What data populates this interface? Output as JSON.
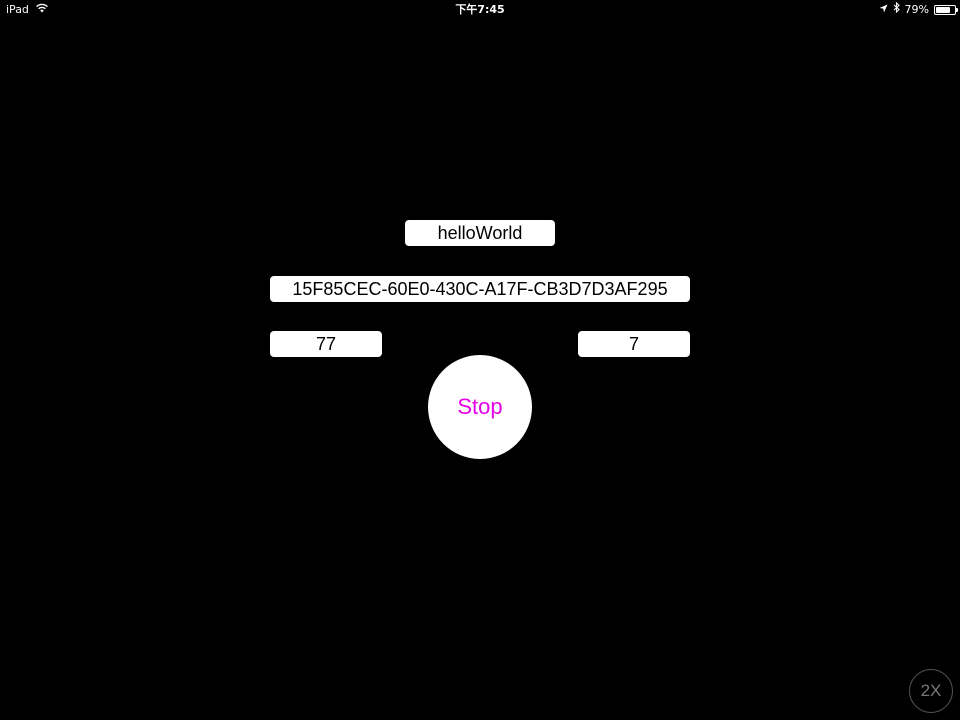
{
  "status_bar": {
    "device": "iPad",
    "time": "下午7:45",
    "battery_percent": "79%",
    "battery_level": 0.79,
    "icons": [
      "wifi-icon",
      "location-arrow-icon",
      "bluetooth-icon",
      "battery-icon"
    ]
  },
  "main": {
    "title_field": "helloWorld",
    "uuid_field": "15F85CEC-60E0-430C-A17F-CB3D7D3AF295",
    "left_value": "77",
    "right_value": "7",
    "stop_button_label": "Stop"
  },
  "zoom_button": {
    "label": "2X"
  },
  "colors": {
    "background": "#000000",
    "field_background": "#ffffff",
    "stop_text": "#e600e6",
    "zoom_border": "#555555"
  }
}
